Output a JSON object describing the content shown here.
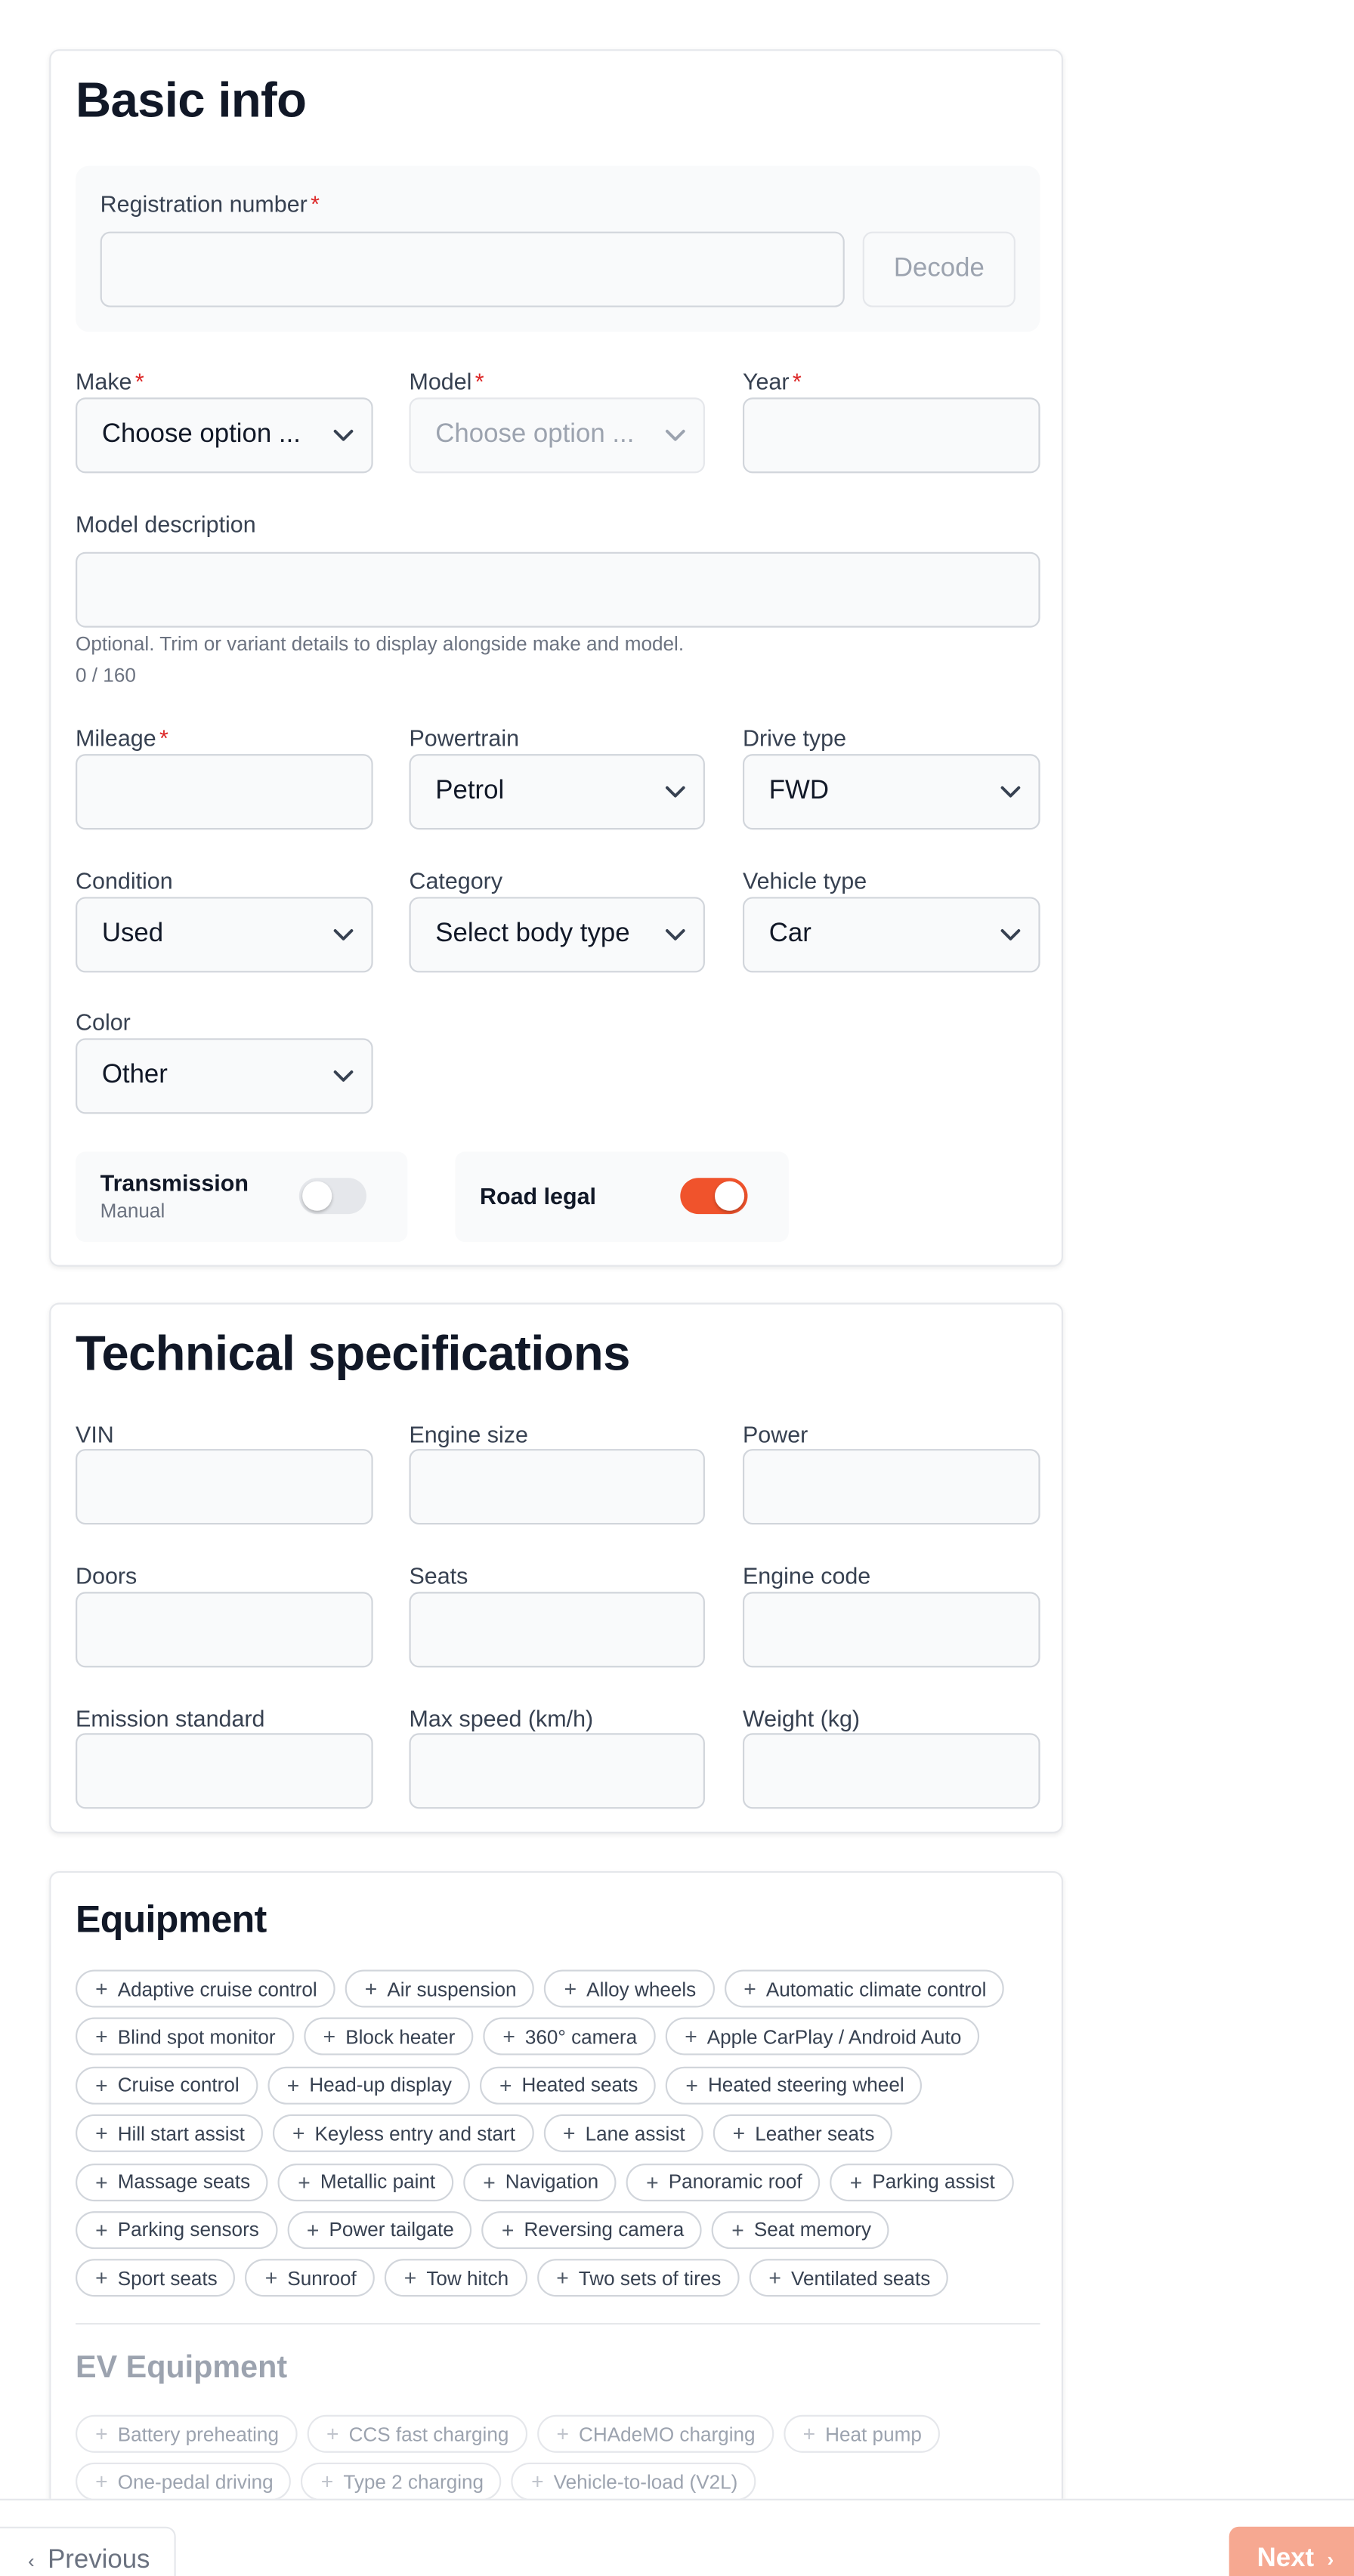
{
  "basic_info": {
    "title": "Basic info",
    "registration": {
      "label": "Registration number",
      "required_mark": "*",
      "value": "",
      "decode_label": "Decode"
    },
    "make": {
      "label": "Make",
      "required_mark": "*",
      "value": "Choose option ..."
    },
    "model": {
      "label": "Model",
      "required_mark": "*",
      "value": "Choose option ..."
    },
    "year": {
      "label": "Year",
      "required_mark": "*",
      "value": ""
    },
    "model_description": {
      "label": "Model description",
      "value": "",
      "hint": "Optional. Trim or variant details to display alongside make and model.",
      "counter": "0 / 160"
    },
    "mileage": {
      "label": "Mileage",
      "required_mark": "*",
      "value": ""
    },
    "powertrain": {
      "label": "Powertrain",
      "value": "Petrol"
    },
    "drive_type": {
      "label": "Drive type",
      "value": "FWD"
    },
    "condition": {
      "label": "Condition",
      "value": "Used"
    },
    "category": {
      "label": "Category",
      "value": "Select body type"
    },
    "vehicle_type": {
      "label": "Vehicle type",
      "value": "Car"
    },
    "color": {
      "label": "Color",
      "value": "Other"
    },
    "transmission": {
      "label": "Transmission",
      "sub": "Manual",
      "on": false
    },
    "road_legal": {
      "label": "Road legal",
      "on": true
    }
  },
  "technical": {
    "title": "Technical specifications",
    "fields": [
      {
        "label": "VIN",
        "value": ""
      },
      {
        "label": "Engine size",
        "value": ""
      },
      {
        "label": "Power",
        "value": ""
      },
      {
        "label": "Doors",
        "value": ""
      },
      {
        "label": "Seats",
        "value": ""
      },
      {
        "label": "Engine code",
        "value": ""
      },
      {
        "label": "Emission standard",
        "value": ""
      },
      {
        "label": "Max speed (km/h)",
        "value": ""
      },
      {
        "label": "Weight (kg)",
        "value": ""
      }
    ]
  },
  "equipment": {
    "title": "Equipment",
    "chip_icon": "plus-icon",
    "rows": [
      [
        "Adaptive cruise control",
        "Air suspension",
        "Alloy wheels",
        "Automatic climate control"
      ],
      [
        "Blind spot monitor",
        "Block heater",
        "360° camera",
        "Apple CarPlay / Android Auto"
      ],
      [
        "Cruise control",
        "Head-up display",
        "Heated seats",
        "Heated steering wheel"
      ],
      [
        "Hill start assist",
        "Keyless entry and start",
        "Lane assist",
        "Leather seats"
      ],
      [
        "Massage seats",
        "Metallic paint",
        "Navigation",
        "Panoramic roof",
        "Parking assist"
      ],
      [
        "Parking sensors",
        "Power tailgate",
        "Reversing camera",
        "Seat memory"
      ],
      [
        "Sport seats",
        "Sunroof",
        "Tow hitch",
        "Two sets of tires",
        "Ventilated seats"
      ]
    ],
    "ev_title": "EV Equipment",
    "ev_rows": [
      [
        "Battery preheating",
        "CCS fast charging",
        "CHAdeMO charging",
        "Heat pump"
      ],
      [
        "One-pedal driving",
        "Type 2 charging",
        "Vehicle-to-load (V2L)"
      ]
    ]
  },
  "footer": {
    "previous_label": "Previous",
    "next_label": "Next"
  },
  "colors": {
    "accent": "#f0532c",
    "required": "#dc2626",
    "next_disabled": "#f6a891"
  }
}
